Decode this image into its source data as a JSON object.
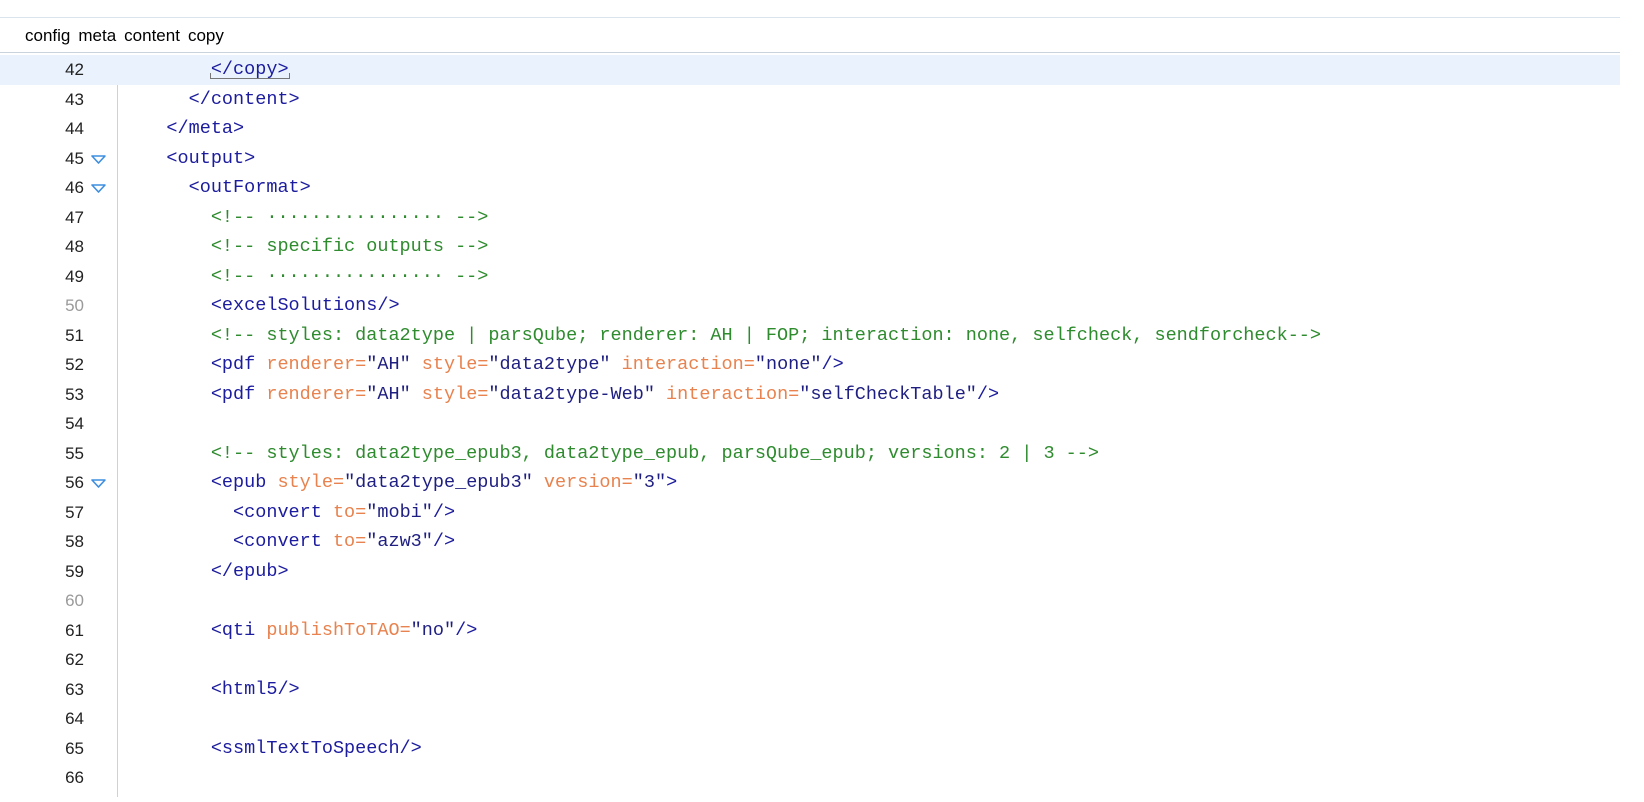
{
  "breadcrumb": [
    "config",
    "meta",
    "content",
    "copy"
  ],
  "colors": {
    "tag": "#1c1c9e",
    "attribute": "#e8824e",
    "value": "#1f1f82",
    "comment": "#2e8b2e",
    "current_line_bg": "#eaf3fd",
    "fold_marker": "#3d8ee0"
  },
  "editor": {
    "current_line": 42,
    "lines": [
      {
        "n": "42",
        "indent": 8,
        "tokens": [
          {
            "t": "tag",
            "v": "</copy>",
            "boxed": true
          }
        ]
      },
      {
        "n": "43",
        "indent": 6,
        "tokens": [
          {
            "t": "tag",
            "v": "</content>"
          }
        ]
      },
      {
        "n": "44",
        "indent": 4,
        "tokens": [
          {
            "t": "tag",
            "v": "</meta>"
          }
        ]
      },
      {
        "n": "45",
        "indent": 4,
        "fold": true,
        "tokens": [
          {
            "t": "tag",
            "v": "<output>"
          }
        ]
      },
      {
        "n": "46",
        "indent": 6,
        "fold": true,
        "tokens": [
          {
            "t": "tag",
            "v": "<outFormat>"
          }
        ]
      },
      {
        "n": "47",
        "indent": 8,
        "tokens": [
          {
            "t": "cmt",
            "v": "<!-- ················ -->"
          }
        ]
      },
      {
        "n": "48",
        "indent": 8,
        "tokens": [
          {
            "t": "cmt",
            "v": "<!-- specific outputs -->"
          }
        ]
      },
      {
        "n": "49",
        "indent": 8,
        "tokens": [
          {
            "t": "cmt",
            "v": "<!-- ················ -->"
          }
        ]
      },
      {
        "n": "50",
        "dim": true,
        "indent": 8,
        "tokens": [
          {
            "t": "tag",
            "v": "<excelSolutions/>"
          }
        ]
      },
      {
        "n": "51",
        "indent": 8,
        "tokens": [
          {
            "t": "cmt",
            "v": "<!-- styles: data2type | parsQube; renderer: AH | FOP; interaction: none, selfcheck, sendforcheck-->"
          }
        ]
      },
      {
        "n": "52",
        "indent": 8,
        "tokens": [
          {
            "t": "tag",
            "v": "<pdf "
          },
          {
            "t": "attr",
            "v": "renderer="
          },
          {
            "t": "val",
            "v": "\"AH\" "
          },
          {
            "t": "attr",
            "v": "style="
          },
          {
            "t": "val",
            "v": "\"data2type\" "
          },
          {
            "t": "attr",
            "v": "interaction="
          },
          {
            "t": "val",
            "v": "\"none\""
          },
          {
            "t": "tag",
            "v": "/>"
          }
        ]
      },
      {
        "n": "53",
        "indent": 8,
        "tokens": [
          {
            "t": "tag",
            "v": "<pdf "
          },
          {
            "t": "attr",
            "v": "renderer="
          },
          {
            "t": "val",
            "v": "\"AH\" "
          },
          {
            "t": "attr",
            "v": "style="
          },
          {
            "t": "val",
            "v": "\"data2type-Web\" "
          },
          {
            "t": "attr",
            "v": "interaction="
          },
          {
            "t": "val",
            "v": "\"selfCheckTable\""
          },
          {
            "t": "tag",
            "v": "/>"
          }
        ]
      },
      {
        "n": "54",
        "indent": 0,
        "tokens": []
      },
      {
        "n": "55",
        "indent": 8,
        "tokens": [
          {
            "t": "cmt",
            "v": "<!-- styles: data2type_epub3, data2type_epub, parsQube_epub; versions: 2 | 3 -->"
          }
        ]
      },
      {
        "n": "56",
        "indent": 8,
        "fold": true,
        "tokens": [
          {
            "t": "tag",
            "v": "<epub "
          },
          {
            "t": "attr",
            "v": "style="
          },
          {
            "t": "val",
            "v": "\"data2type_epub3\" "
          },
          {
            "t": "attr",
            "v": "version="
          },
          {
            "t": "val",
            "v": "\"3\""
          },
          {
            "t": "tag",
            "v": ">"
          }
        ]
      },
      {
        "n": "57",
        "indent": 10,
        "tokens": [
          {
            "t": "tag",
            "v": "<convert "
          },
          {
            "t": "attr",
            "v": "to="
          },
          {
            "t": "val",
            "v": "\"mobi\""
          },
          {
            "t": "tag",
            "v": "/>"
          }
        ]
      },
      {
        "n": "58",
        "indent": 10,
        "tokens": [
          {
            "t": "tag",
            "v": "<convert "
          },
          {
            "t": "attr",
            "v": "to="
          },
          {
            "t": "val",
            "v": "\"azw3\""
          },
          {
            "t": "tag",
            "v": "/>"
          }
        ]
      },
      {
        "n": "59",
        "indent": 8,
        "tokens": [
          {
            "t": "tag",
            "v": "</epub>"
          }
        ]
      },
      {
        "n": "60",
        "dim": true,
        "indent": 0,
        "tokens": []
      },
      {
        "n": "61",
        "indent": 8,
        "tokens": [
          {
            "t": "tag",
            "v": "<qti "
          },
          {
            "t": "attr",
            "v": "publishToTAO="
          },
          {
            "t": "val",
            "v": "\"no\""
          },
          {
            "t": "tag",
            "v": "/>"
          }
        ]
      },
      {
        "n": "62",
        "indent": 0,
        "tokens": []
      },
      {
        "n": "63",
        "indent": 8,
        "tokens": [
          {
            "t": "tag",
            "v": "<html5/>"
          }
        ]
      },
      {
        "n": "64",
        "indent": 0,
        "tokens": []
      },
      {
        "n": "65",
        "indent": 8,
        "tokens": [
          {
            "t": "tag",
            "v": "<ssmlTextToSpeech/>"
          }
        ]
      },
      {
        "n": "66",
        "indent": 0,
        "tokens": []
      }
    ]
  }
}
